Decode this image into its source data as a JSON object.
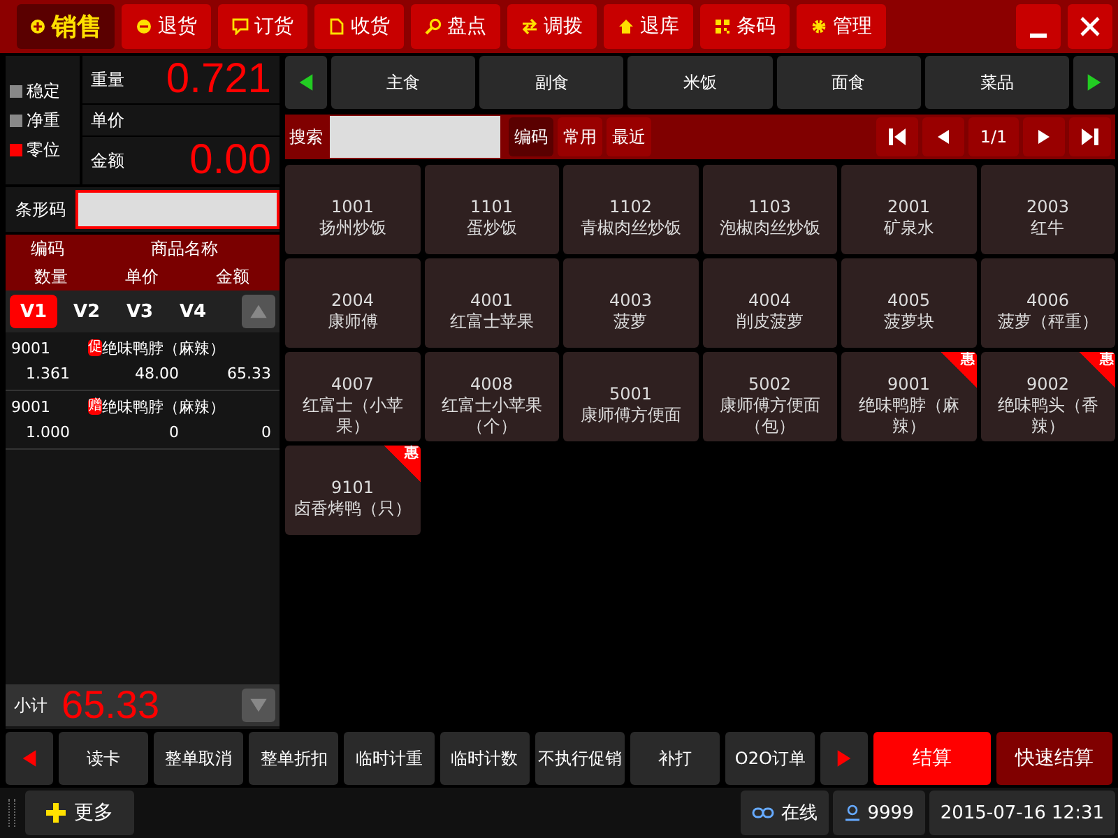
{
  "nav_tabs": [
    {
      "label": "销售",
      "selected": true
    },
    {
      "label": "退货",
      "selected": false
    },
    {
      "label": "订货",
      "selected": false
    },
    {
      "label": "收货",
      "selected": false
    },
    {
      "label": "盘点",
      "selected": false
    },
    {
      "label": "调拨",
      "selected": false
    },
    {
      "label": "退库",
      "selected": false
    },
    {
      "label": "条码",
      "selected": false
    },
    {
      "label": "管理",
      "selected": false
    }
  ],
  "scale": {
    "indicators": [
      {
        "label": "稳定",
        "on": false
      },
      {
        "label": "净重",
        "on": false
      },
      {
        "label": "零位",
        "on": true
      }
    ],
    "fields": [
      {
        "label": "重量",
        "value": "0.721"
      },
      {
        "label": "单价"
      },
      {
        "label": "金额",
        "value": "0.00"
      }
    ]
  },
  "barcode": {
    "label": "条形码"
  },
  "order_header": {
    "row_1": [
      "编码",
      "商品名称"
    ],
    "row_2": [
      "数量",
      "单价",
      "金额"
    ]
  },
  "versions": [
    {
      "label": "V1",
      "selected": true
    },
    {
      "label": "V2",
      "selected": false
    },
    {
      "label": "V3",
      "selected": false
    },
    {
      "label": "V4",
      "selected": false
    }
  ],
  "order_lines": [
    {
      "code": "9001",
      "tag": "促",
      "name": "绝味鸭脖（麻辣）",
      "qty": "1.361",
      "price": "48.00",
      "amount": "65.33"
    },
    {
      "code": "9001",
      "tag": "赠",
      "name": "绝味鸭脖（麻辣）",
      "qty": "1.000",
      "price": "0",
      "amount": "0"
    }
  ],
  "subtotal": {
    "label": "小计",
    "value": "65.33"
  },
  "categories": [
    "主食",
    "副食",
    "米饭",
    "面食",
    "菜品"
  ],
  "search": {
    "label": "搜索",
    "filters": [
      {
        "label": "编码",
        "selected": true
      },
      {
        "label": "常用",
        "selected": false
      },
      {
        "label": "最近",
        "selected": false
      }
    ],
    "page": "1/1"
  },
  "products": [
    {
      "code": "1001",
      "name": "扬州炒饭",
      "promo": false
    },
    {
      "code": "1101",
      "name": "蛋炒饭",
      "promo": false
    },
    {
      "code": "1102",
      "name": "青椒肉丝炒饭",
      "promo": false
    },
    {
      "code": "1103",
      "name": "泡椒肉丝炒饭",
      "promo": false
    },
    {
      "code": "2001",
      "name": "矿泉水",
      "promo": false
    },
    {
      "code": "2003",
      "name": "红牛",
      "promo": false
    },
    {
      "code": "2004",
      "name": "康师傅",
      "promo": false
    },
    {
      "code": "4001",
      "name": "红富士苹果",
      "promo": false
    },
    {
      "code": "4003",
      "name": "菠萝",
      "promo": false
    },
    {
      "code": "4004",
      "name": "削皮菠萝",
      "promo": false
    },
    {
      "code": "4005",
      "name": "菠萝块",
      "promo": false
    },
    {
      "code": "4006",
      "name": "菠萝（秤重）",
      "promo": false
    },
    {
      "code": "4007",
      "name": "红富士（小苹果）",
      "promo": false
    },
    {
      "code": "4008",
      "name": "红富士小苹果（个）",
      "promo": false
    },
    {
      "code": "5001",
      "name": "康师傅方便面",
      "promo": false
    },
    {
      "code": "5002",
      "name": "康师傅方便面（包）",
      "promo": false
    },
    {
      "code": "9001",
      "name": "绝味鸭脖（麻辣）",
      "promo": true,
      "promo_label": "惠"
    },
    {
      "code": "9002",
      "name": "绝味鸭头（香辣）",
      "promo": true,
      "promo_label": "惠"
    },
    {
      "code": "9101",
      "name": "卤香烤鸭（只）",
      "promo": true,
      "promo_label": "惠"
    }
  ],
  "actions": [
    {
      "label": "读卡",
      "kind": "normal"
    },
    {
      "label": "整单取消",
      "kind": "normal"
    },
    {
      "label": "整单折扣",
      "kind": "normal"
    },
    {
      "label": "临时计重",
      "kind": "normal"
    },
    {
      "label": "临时计数",
      "kind": "normal"
    },
    {
      "label": "不执行促销",
      "kind": "normal"
    },
    {
      "label": "补打",
      "kind": "normal"
    },
    {
      "label": "O2O订单",
      "kind": "normal"
    },
    {
      "label": "结算",
      "kind": "checkout"
    },
    {
      "label": "快速结算",
      "kind": "quick"
    }
  ],
  "status_bar": {
    "more": "更多",
    "connection": "在线",
    "user": "9999",
    "datetime": "2015-07-16 12:31"
  }
}
